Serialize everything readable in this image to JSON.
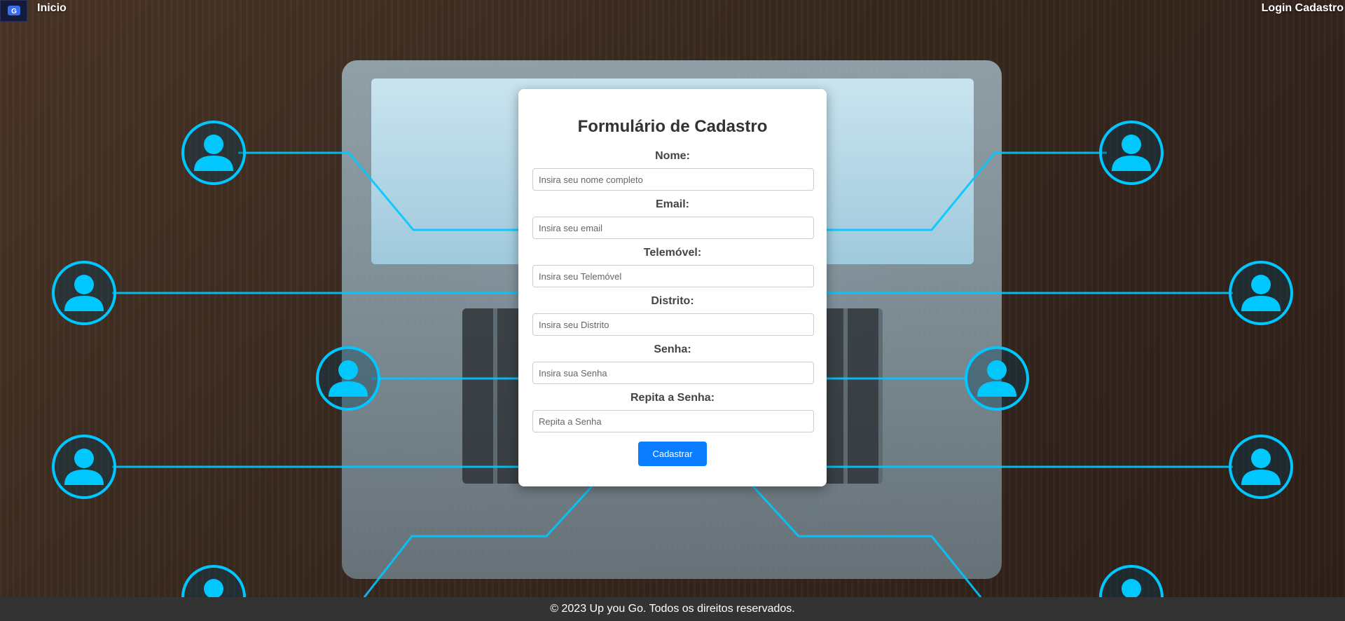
{
  "nav": {
    "home_label": "Inicio",
    "right_label": "Login Cadastro"
  },
  "form": {
    "title": "Formulário de Cadastro",
    "fields": [
      {
        "label": "Nome:",
        "placeholder": "Insira seu nome completo"
      },
      {
        "label": "Email:",
        "placeholder": "Insira seu email"
      },
      {
        "label": "Telemóvel:",
        "placeholder": "Insira seu Telemóvel"
      },
      {
        "label": "Distrito:",
        "placeholder": "Insira seu Distrito"
      },
      {
        "label": "Senha:",
        "placeholder": "Insira sua Senha"
      },
      {
        "label": "Repita a Senha:",
        "placeholder": "Repita a Senha"
      }
    ],
    "submit_label": "Cadastrar"
  },
  "footer": {
    "text": "© 2023 Up you Go. Todos os direitos reservados."
  },
  "colors": {
    "accent": "#0a7cff",
    "network": "#00c8ff",
    "footer_bg": "#333333"
  },
  "icons": {
    "logo": "brand-logo-icon",
    "avatar": "user-avatar-icon"
  }
}
